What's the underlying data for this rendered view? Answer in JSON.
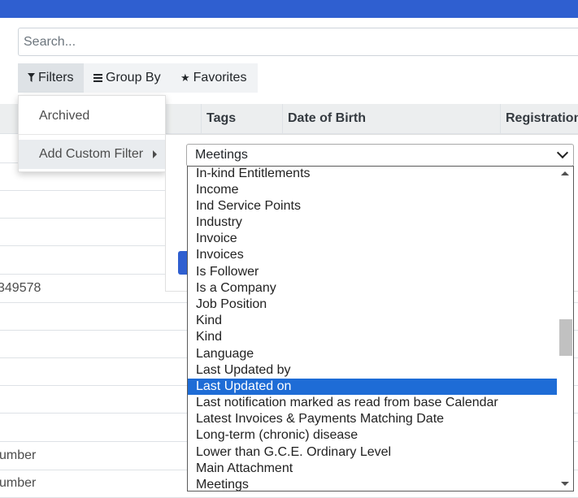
{
  "search": {
    "placeholder": "Search..."
  },
  "toolbar": {
    "filters_label": "Filters",
    "groupby_label": "Group By",
    "favorites_label": "Favorites"
  },
  "filters_menu": {
    "items": [
      "Archived",
      "Add Custom Filter"
    ]
  },
  "table": {
    "columns": [
      "Tags",
      "Date of Birth",
      "Registration"
    ],
    "row_fragments": [
      "349578",
      "umber",
      "umber"
    ]
  },
  "custom_filter": {
    "field_value": "Meetings",
    "options": [
      "In-kind Entitlements",
      "Income",
      "Ind Service Points",
      "Industry",
      "Invoice",
      "Invoices",
      "Is Follower",
      "Is a Company",
      "Job Position",
      "Kind",
      "Kind",
      "Language",
      "Last Updated by",
      "Last Updated on",
      "Last notification marked as read from base Calendar",
      "Latest Invoices & Payments Matching Date",
      "Long-term (chronic) disease",
      "Lower than G.C.E. Ordinary Level",
      "Main Attachment",
      "Meetings"
    ],
    "selected_option": "Last Updated on"
  },
  "colors": {
    "topbar": "#2f5fd0",
    "selection": "#1e6cd6"
  },
  "icons": {
    "filters": "funnel-icon",
    "groupby": "list-icon",
    "favorites": "star-icon"
  }
}
